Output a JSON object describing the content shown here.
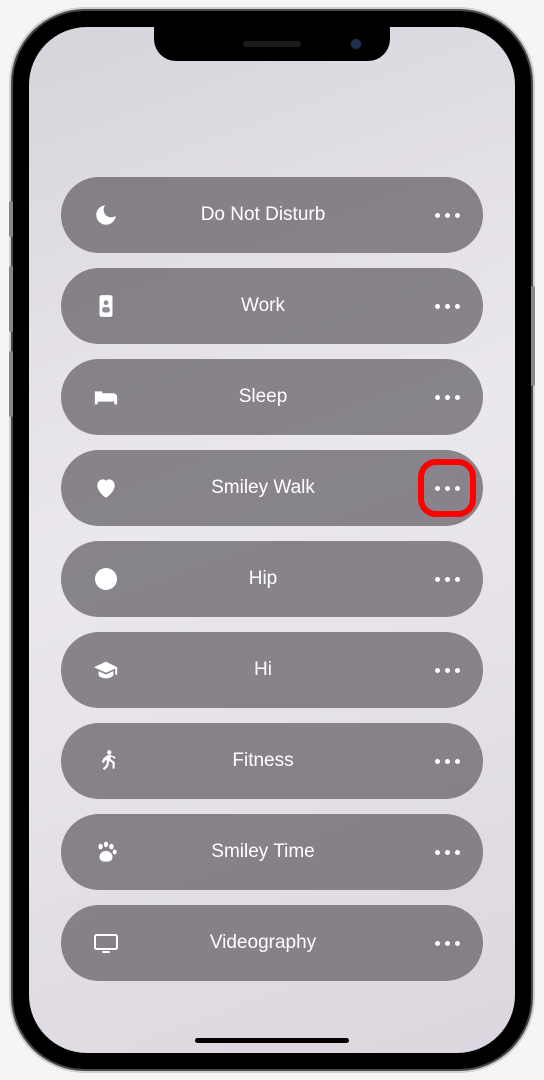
{
  "focusModes": [
    {
      "id": "dnd",
      "label": "Do Not Disturb",
      "icon": "moon-icon",
      "highlighted": false
    },
    {
      "id": "work",
      "label": "Work",
      "icon": "id-badge-icon",
      "highlighted": false
    },
    {
      "id": "sleep",
      "label": "Sleep",
      "icon": "bed-icon",
      "highlighted": false
    },
    {
      "id": "smileywalk",
      "label": "Smiley Walk",
      "icon": "heart-icon",
      "highlighted": true
    },
    {
      "id": "hip",
      "label": "Hip",
      "icon": "circle-icon",
      "highlighted": false
    },
    {
      "id": "hi",
      "label": "Hi",
      "icon": "graduation-cap-icon",
      "highlighted": false
    },
    {
      "id": "fitness",
      "label": "Fitness",
      "icon": "running-icon",
      "highlighted": false
    },
    {
      "id": "smileytime",
      "label": "Smiley Time",
      "icon": "paw-icon",
      "highlighted": false
    },
    {
      "id": "videography",
      "label": "Videography",
      "icon": "display-icon",
      "highlighted": false
    }
  ]
}
